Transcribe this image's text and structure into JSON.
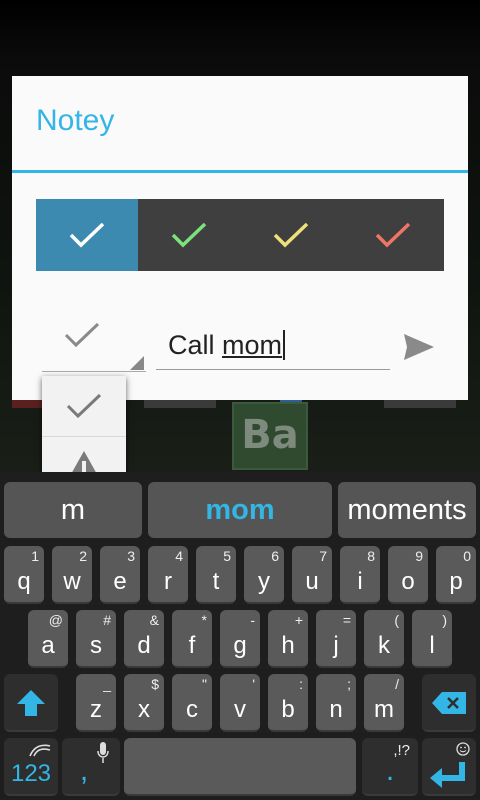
{
  "app": {
    "title": "Notey"
  },
  "colors": {
    "accent": "#33b5e5",
    "selected_bg": "#3c8aaf",
    "bar_bg": "#3f3f3f"
  },
  "color_options": [
    {
      "name": "blue",
      "check_color": "#ffffff",
      "selected": true
    },
    {
      "name": "green",
      "check_color": "#7be37b"
    },
    {
      "name": "yellow",
      "check_color": "#efe17a"
    },
    {
      "name": "red",
      "check_color": "#f07565"
    }
  ],
  "note": {
    "value_prefix": "Call ",
    "value_word": "mom"
  },
  "type_menu": [
    {
      "icon": "check-icon"
    },
    {
      "icon": "warning-icon"
    },
    {
      "icon": "pencil-icon"
    },
    {
      "icon": "star-icon"
    }
  ],
  "background": {
    "tile_text": "Ba"
  },
  "keyboard": {
    "suggestions": [
      "m",
      "mom",
      "moments"
    ],
    "row1": [
      {
        "k": "q",
        "a": "1"
      },
      {
        "k": "w",
        "a": "2"
      },
      {
        "k": "e",
        "a": "3"
      },
      {
        "k": "r",
        "a": "4"
      },
      {
        "k": "t",
        "a": "5"
      },
      {
        "k": "y",
        "a": "6"
      },
      {
        "k": "u",
        "a": "7"
      },
      {
        "k": "i",
        "a": "8"
      },
      {
        "k": "o",
        "a": "9"
      },
      {
        "k": "p",
        "a": "0"
      }
    ],
    "row2": [
      {
        "k": "a",
        "a": "@"
      },
      {
        "k": "s",
        "a": "#"
      },
      {
        "k": "d",
        "a": "&"
      },
      {
        "k": "f",
        "a": "*"
      },
      {
        "k": "g",
        "a": "-"
      },
      {
        "k": "h",
        "a": "+"
      },
      {
        "k": "j",
        "a": "="
      },
      {
        "k": "k",
        "a": "("
      },
      {
        "k": "l",
        "a": ")"
      }
    ],
    "row3": [
      {
        "k": "z",
        "a": "_"
      },
      {
        "k": "x",
        "a": "$"
      },
      {
        "k": "c",
        "a": "\""
      },
      {
        "k": "v",
        "a": "'"
      },
      {
        "k": "b",
        "a": ":"
      },
      {
        "k": "n",
        "a": ";"
      },
      {
        "k": "m",
        "a": "/"
      }
    ],
    "numbers_label": "123",
    "comma_label": ",",
    "period_label": ".",
    "period_alt": ",!?"
  }
}
